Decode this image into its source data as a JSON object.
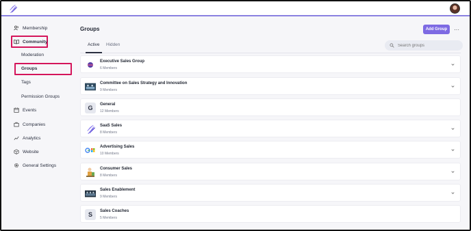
{
  "sidebar": {
    "membership": "Membership",
    "community": "Community",
    "moderation": "Moderation",
    "groups": "Groups",
    "tags": "Tags",
    "permission_groups": "Permission Groups",
    "events": "Events",
    "companies": "Companies",
    "analytics": "Analytics",
    "website": "Website",
    "general_settings": "General Settings"
  },
  "main": {
    "title": "Groups",
    "add_button": "Add Group",
    "more_button": "···",
    "tabs": [
      {
        "label": "Active"
      },
      {
        "label": "Hidden"
      }
    ],
    "search_placeholder": "Search groups",
    "groups": [
      {
        "name": "Executive Sales Group",
        "members": "6 Members",
        "thumb": "purple-dot"
      },
      {
        "name": "Committee on Sales Strategy and Innovation",
        "members": "9 Members",
        "thumb": "photo"
      },
      {
        "name": "General",
        "members": "12 Members",
        "thumb": "letter",
        "letter": "G"
      },
      {
        "name": "SaaS Sales",
        "members": "8 Members",
        "thumb": "logo"
      },
      {
        "name": "Advertising Sales",
        "members": "10 Members",
        "thumb": "google-ms"
      },
      {
        "name": "Consumer Sales",
        "members": "8 Members",
        "thumb": "illustration"
      },
      {
        "name": "Sales Enablement",
        "members": "9 Members",
        "thumb": "photo"
      },
      {
        "name": "Sales Coaches",
        "members": "5 Members",
        "thumb": "letter",
        "letter": "S"
      }
    ]
  },
  "colors": {
    "accent": "#7d6ae3",
    "highlight": "#d4145a"
  }
}
